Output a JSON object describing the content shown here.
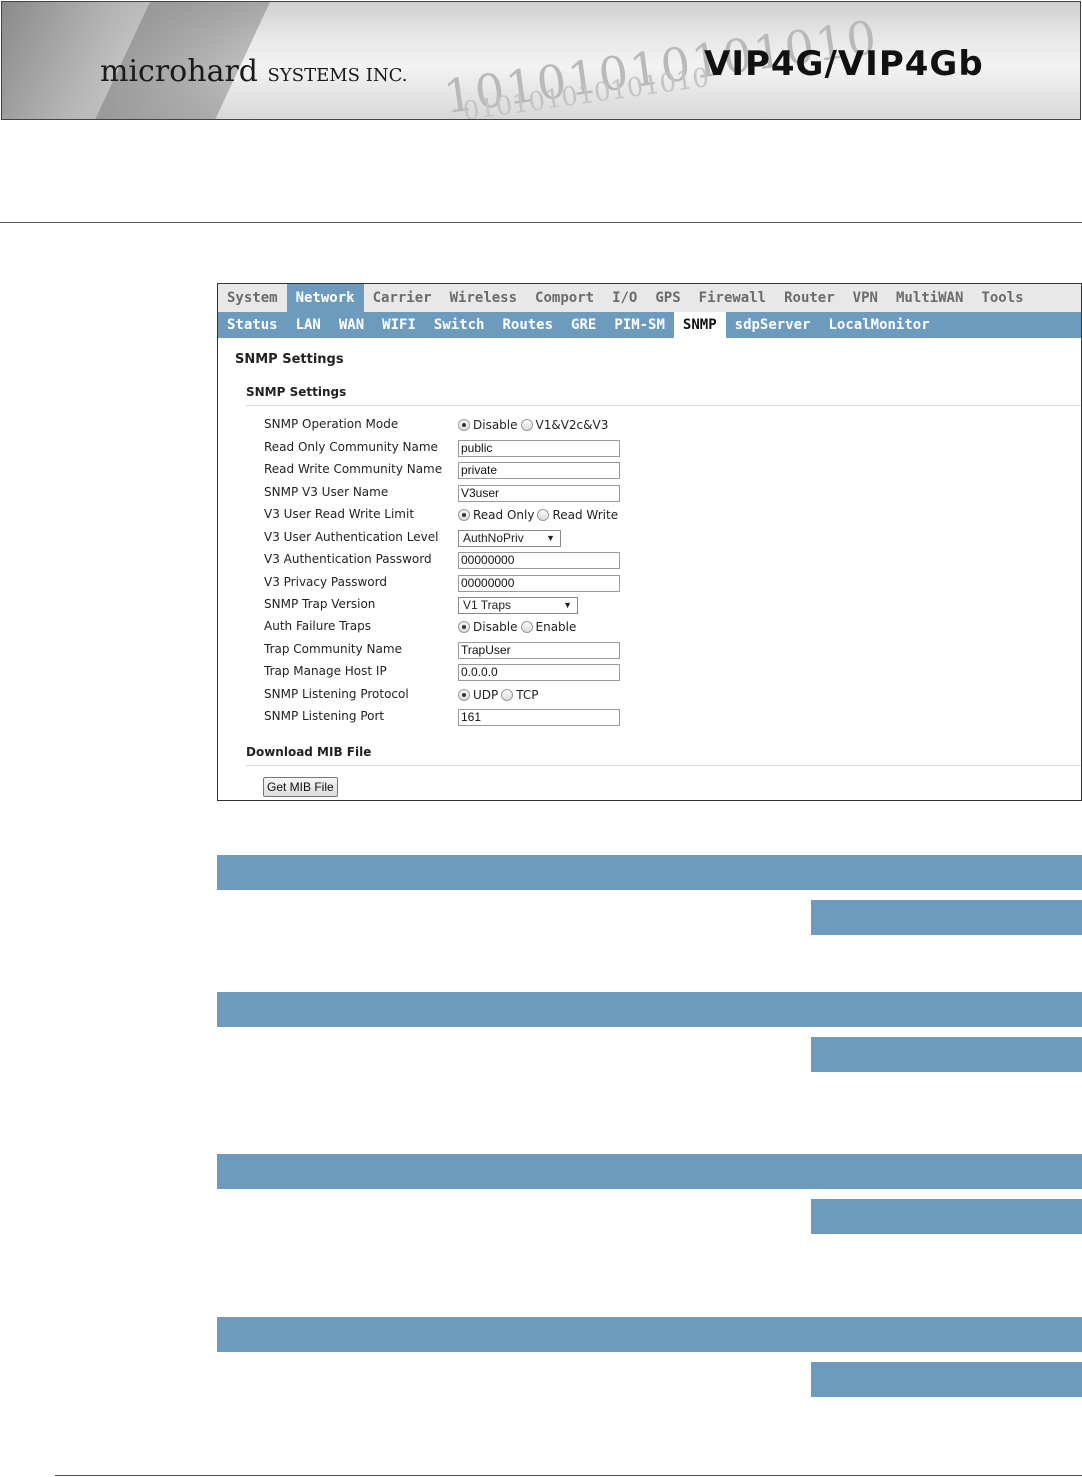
{
  "banner": {
    "company": "microhard",
    "company_suffix": "SYSTEMS INC.",
    "product": "VIP4G/VIP4Gb",
    "binary_line1": "10101010101010",
    "binary_line2": "010101010101010"
  },
  "top_nav": [
    "System",
    "Network",
    "Carrier",
    "Wireless",
    "Comport",
    "I/O",
    "GPS",
    "Firewall",
    "Router",
    "VPN",
    "MultiWAN",
    "Tools"
  ],
  "top_nav_active": "Network",
  "sub_nav": [
    "Status",
    "LAN",
    "WAN",
    "WIFI",
    "Switch",
    "Routes",
    "GRE",
    "PIM-SM",
    "SNMP",
    "sdpServer",
    "LocalMonitor"
  ],
  "sub_nav_active": "SNMP",
  "page_title": "SNMP Settings",
  "section_title": "SNMP Settings",
  "fields": {
    "op_mode": {
      "label": "SNMP Operation Mode",
      "opt1": "Disable",
      "opt2": "V1&V2c&V3"
    },
    "ro_comm": {
      "label": "Read Only Community Name",
      "value": "public"
    },
    "rw_comm": {
      "label": "Read Write Community Name",
      "value": "private"
    },
    "v3_user": {
      "label": "SNMP V3 User Name",
      "value": "V3user"
    },
    "v3_limit": {
      "label": "V3 User Read Write Limit",
      "opt1": "Read Only",
      "opt2": "Read Write"
    },
    "v3_auth_level": {
      "label": "V3 User Authentication Level",
      "value": "AuthNoPriv"
    },
    "v3_auth_pw": {
      "label": "V3 Authentication Password",
      "value": "00000000"
    },
    "v3_priv_pw": {
      "label": "V3 Privacy Password",
      "value": "00000000"
    },
    "trap_version": {
      "label": "SNMP Trap Version",
      "value": "V1 Traps"
    },
    "auth_fail": {
      "label": "Auth Failure Traps",
      "opt1": "Disable",
      "opt2": "Enable"
    },
    "trap_comm": {
      "label": "Trap Community Name",
      "value": "TrapUser"
    },
    "trap_host": {
      "label": "Trap Manage Host IP",
      "value": "0.0.0.0"
    },
    "listen_proto": {
      "label": "SNMP Listening Protocol",
      "opt1": "UDP",
      "opt2": "TCP"
    },
    "listen_port": {
      "label": "SNMP Listening Port",
      "value": "161"
    }
  },
  "download_section_title": "Download MIB File",
  "get_mib_button": "Get MIB File",
  "colors": {
    "accent": "#6d9bbe",
    "top_nav_bg": "#e8e8e8"
  }
}
